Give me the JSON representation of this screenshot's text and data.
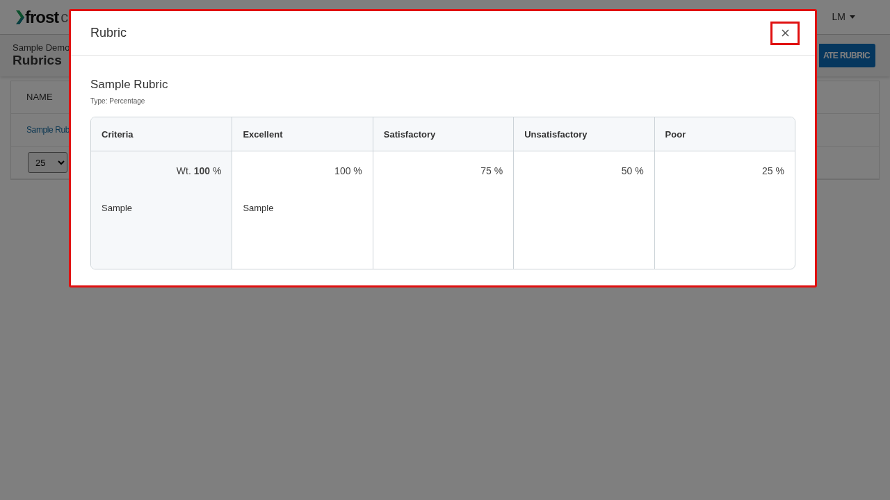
{
  "app": {
    "logo": "frost",
    "logo_suffix": "c",
    "user_menu": "LM"
  },
  "page": {
    "breadcrumb": "Sample Demo",
    "title": "Rubrics",
    "create_button": "ATE RUBRIC"
  },
  "list": {
    "columns": [
      "NAME"
    ],
    "rows": [
      {
        "name": "Sample Rub"
      }
    ],
    "page_size": "25"
  },
  "modal": {
    "title": "Rubric",
    "rubric_name": "Sample Rubric",
    "type": "Type: Percentage",
    "criteria_header": "Criteria",
    "criteria": [
      {
        "weight_label": "Wt.",
        "weight": "100",
        "unit": "%",
        "name": "Sample"
      }
    ],
    "levels": [
      {
        "name": "Excellent",
        "value": "100 %",
        "description": "Sample"
      },
      {
        "name": "Satisfactory",
        "value": "75 %"
      },
      {
        "name": "Unsatisfactory",
        "value": "50 %"
      },
      {
        "name": "Poor",
        "value": "25 %"
      }
    ]
  }
}
